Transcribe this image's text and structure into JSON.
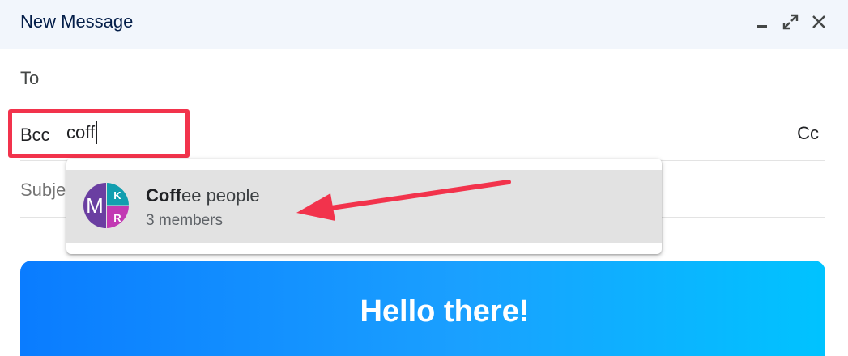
{
  "window": {
    "title": "New Message",
    "controls": [
      "minimize-icon",
      "maximize-icon",
      "close-icon"
    ]
  },
  "fields": {
    "to_label": "To",
    "bcc_label": "Bcc",
    "bcc_value": "coff",
    "cc_label": "Cc",
    "subject_placeholder": "Subject"
  },
  "suggestion": {
    "name_match": "Coff",
    "name_rest": "ee people",
    "subtitle": "3 members",
    "avatar": {
      "letters": [
        "M",
        "K",
        "R"
      ],
      "colors": [
        "#6a3ea1",
        "#129eaf",
        "#c239b3"
      ]
    }
  },
  "banner": {
    "text": "Hello there!"
  },
  "colors": {
    "highlight_box": "#f2334c",
    "arrow": "#f2334c",
    "titlebar": "#f2f6fc"
  }
}
